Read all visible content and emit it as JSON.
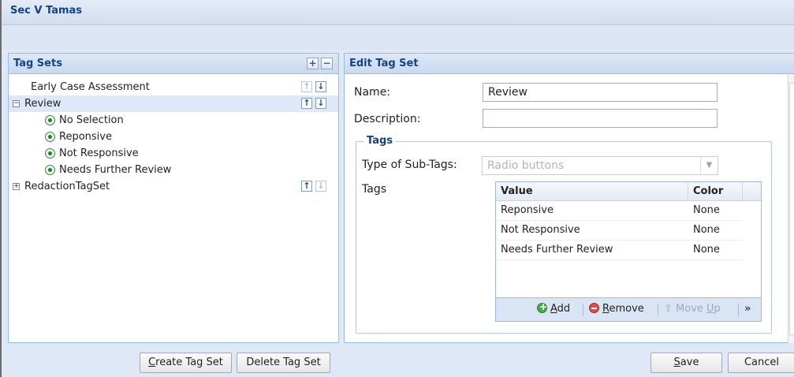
{
  "window": {
    "title": "Sec V Tamas"
  },
  "tag_sets_panel": {
    "title": "Tag Sets",
    "add_icon": "plus-icon",
    "remove_icon": "minus-icon",
    "items": [
      {
        "label": "Early Case Assessment",
        "expandable": false,
        "children": []
      },
      {
        "label": "Review",
        "expandable": true,
        "expanded": true,
        "selected": true,
        "children": [
          "No Selection",
          "Reponsive",
          "Not Responsive",
          "Needs Further Review"
        ]
      },
      {
        "label": "RedactionTagSet",
        "expandable": true,
        "expanded": false,
        "children": []
      }
    ]
  },
  "edit_panel": {
    "title": "Edit Tag Set",
    "name_label": "Name:",
    "name_value": "Review",
    "description_label": "Description:",
    "description_value": "",
    "tags_legend": "Tags",
    "subtag_type_label": "Type of Sub-Tags:",
    "subtag_type_value": "Radio buttons",
    "tags_label": "Tags",
    "grid": {
      "columns": [
        "Value",
        "Color"
      ],
      "rows": [
        {
          "value": "Reponsive",
          "color": "None"
        },
        {
          "value": "Not Responsive",
          "color": "None"
        },
        {
          "value": "Needs Further Review",
          "color": "None"
        }
      ],
      "toolbar": {
        "add": {
          "key": "A",
          "rest": "dd"
        },
        "remove": {
          "key": "R",
          "rest": "emove"
        },
        "move_up": {
          "prefix": "Move ",
          "key": "U",
          "rest": "p"
        },
        "more": "»"
      }
    }
  },
  "footer": {
    "create": {
      "key": "C",
      "rest": "reate Tag Set"
    },
    "delete": "Delete Tag Set",
    "save": {
      "key": "S",
      "rest": "ave"
    },
    "cancel": "Cancel"
  },
  "colors": {
    "accent": "#15428b",
    "panel_border": "#99bbe8",
    "panel_bg": "#dfe8f6"
  }
}
